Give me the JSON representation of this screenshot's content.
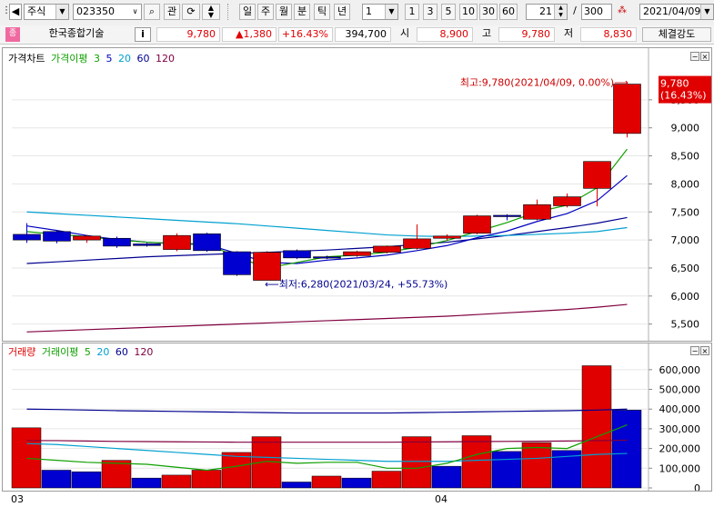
{
  "toolbar": {
    "market": "주식",
    "code": "023350",
    "btn_gwan": "관",
    "periods": [
      "일",
      "주",
      "월",
      "분",
      "틱",
      "년"
    ],
    "active_period": "일",
    "interval": "1",
    "quick": [
      "1",
      "3",
      "5",
      "10",
      "30",
      "60"
    ],
    "count": "21",
    "total": "300",
    "slash": "/",
    "date": "2021/04/09"
  },
  "info": {
    "badge": "종",
    "name": "한국종합기술",
    "i_label": "i",
    "price": "9,780",
    "change": "▲1,380",
    "rate": "+16.43%",
    "volume": "394,700",
    "open_label": "시",
    "open": "8,900",
    "high_label": "고",
    "high": "9,780",
    "low_label": "저",
    "low": "8,830",
    "strength_label": "체결강도"
  },
  "price_legend": {
    "title": "가격차트",
    "ma_label": "가격이평",
    "ma1": "3",
    "ma2": "5",
    "ma3": "20",
    "ma4": "60",
    "ma5": "120"
  },
  "volume_legend": {
    "title": "거래량",
    "ma_label": "거래이평",
    "ma1": "5",
    "ma2": "20",
    "ma3": "60",
    "ma4": "120"
  },
  "annotations": {
    "max": "최고:9,780(2021/04/09, 0.00%)⟶",
    "min": "⟵최저:6,280(2021/03/24, +55.73%)",
    "last_price": "9,780",
    "last_rate": "(16.43%)"
  },
  "x_labels": [
    "03",
    "04"
  ],
  "colors": {
    "up": "#e00000",
    "down": "#0000d0",
    "ma3": "#0fa000",
    "ma5": "#0000c0",
    "ma20": "#00a0d0",
    "ma60": "#000090",
    "ma120": "#800040"
  },
  "chart_data": [
    {
      "type": "candlestick",
      "ylim": [
        5300,
        10000
      ],
      "yticks": [
        "5,500",
        "6,000",
        "6,500",
        "7,000",
        "7,500",
        "8,000",
        "8,500",
        "9,000",
        "9,500"
      ],
      "ytick_values": [
        5500,
        6000,
        6500,
        7000,
        7500,
        8000,
        8500,
        9000,
        9500
      ],
      "candles": [
        {
          "o": 7000,
          "c": 7100,
          "h": 7300,
          "l": 6950,
          "dir": "down"
        },
        {
          "o": 7150,
          "c": 6980,
          "h": 7180,
          "l": 6940,
          "dir": "down"
        },
        {
          "o": 7000,
          "c": 7070,
          "h": 7090,
          "l": 6950,
          "dir": "up"
        },
        {
          "o": 7030,
          "c": 6890,
          "h": 7060,
          "l": 6860,
          "dir": "down"
        },
        {
          "o": 6930,
          "c": 6900,
          "h": 6950,
          "l": 6880,
          "dir": "down"
        },
        {
          "o": 6830,
          "c": 7080,
          "h": 7120,
          "l": 6800,
          "dir": "up"
        },
        {
          "o": 7110,
          "c": 6810,
          "h": 7130,
          "l": 6790,
          "dir": "down"
        },
        {
          "o": 6790,
          "c": 6380,
          "h": 6800,
          "l": 6360,
          "dir": "down"
        },
        {
          "o": 6280,
          "c": 6780,
          "h": 6800,
          "l": 6280,
          "dir": "up"
        },
        {
          "o": 6810,
          "c": 6680,
          "h": 6830,
          "l": 6660,
          "dir": "down"
        },
        {
          "o": 6690,
          "c": 6700,
          "h": 6720,
          "l": 6660,
          "dir": "down"
        },
        {
          "o": 6720,
          "c": 6790,
          "h": 6810,
          "l": 6700,
          "dir": "up"
        },
        {
          "o": 6780,
          "c": 6890,
          "h": 6900,
          "l": 6760,
          "dir": "up"
        },
        {
          "o": 6850,
          "c": 7020,
          "h": 7280,
          "l": 6830,
          "dir": "up"
        },
        {
          "o": 7030,
          "c": 7070,
          "h": 7100,
          "l": 6990,
          "dir": "up"
        },
        {
          "o": 7120,
          "c": 7430,
          "h": 7450,
          "l": 7100,
          "dir": "up"
        },
        {
          "o": 7430,
          "c": 7440,
          "h": 7460,
          "l": 7350,
          "dir": "down"
        },
        {
          "o": 7370,
          "c": 7630,
          "h": 7720,
          "l": 7350,
          "dir": "up"
        },
        {
          "o": 7610,
          "c": 7770,
          "h": 7830,
          "l": 7580,
          "dir": "up"
        },
        {
          "o": 7920,
          "c": 8400,
          "h": 8400,
          "l": 7600,
          "dir": "up"
        },
        {
          "o": 8900,
          "c": 9780,
          "h": 9780,
          "l": 8830,
          "dir": "up"
        }
      ],
      "ma3": [
        7150,
        7100,
        7060,
        7000,
        6960,
        6940,
        6930,
        6700,
        6500,
        6600,
        6700,
        6730,
        6780,
        6870,
        6990,
        7150,
        7310,
        7500,
        7620,
        7930,
        8620
      ],
      "ma5": [
        7250,
        7170,
        7080,
        7010,
        6960,
        6930,
        6920,
        6760,
        6600,
        6580,
        6640,
        6680,
        6730,
        6810,
        6900,
        7040,
        7160,
        7330,
        7470,
        7700,
        8150
      ],
      "ma20": [
        7500,
        7470,
        7440,
        7410,
        7380,
        7350,
        7320,
        7290,
        7250,
        7210,
        7170,
        7130,
        7090,
        7070,
        7060,
        7070,
        7080,
        7100,
        7120,
        7150,
        7220
      ],
      "ma60": [
        6580,
        6610,
        6640,
        6670,
        6700,
        6720,
        6740,
        6760,
        6780,
        6800,
        6820,
        6850,
        6880,
        6920,
        6960,
        7020,
        7080,
        7150,
        7220,
        7300,
        7400
      ],
      "ma120": [
        5360,
        5380,
        5400,
        5420,
        5440,
        5460,
        5480,
        5500,
        5520,
        5540,
        5560,
        5580,
        5600,
        5620,
        5640,
        5670,
        5700,
        5730,
        5760,
        5800,
        5850
      ]
    },
    {
      "type": "bar",
      "ylim": [
        0,
        650000
      ],
      "yticks": [
        "0",
        "100,000",
        "200,000",
        "300,000",
        "400,000",
        "500,000",
        "600,000"
      ],
      "ytick_values": [
        0,
        100000,
        200000,
        300000,
        400000,
        500000,
        600000
      ],
      "bars": [
        {
          "v": 305000,
          "dir": "up"
        },
        {
          "v": 90000,
          "dir": "down"
        },
        {
          "v": 82000,
          "dir": "down"
        },
        {
          "v": 140000,
          "dir": "up"
        },
        {
          "v": 50000,
          "dir": "down"
        },
        {
          "v": 65000,
          "dir": "up"
        },
        {
          "v": 90000,
          "dir": "up"
        },
        {
          "v": 180000,
          "dir": "up"
        },
        {
          "v": 260000,
          "dir": "up"
        },
        {
          "v": 30000,
          "dir": "down"
        },
        {
          "v": 60000,
          "dir": "up"
        },
        {
          "v": 50000,
          "dir": "down"
        },
        {
          "v": 85000,
          "dir": "up"
        },
        {
          "v": 260000,
          "dir": "up"
        },
        {
          "v": 110000,
          "dir": "down"
        },
        {
          "v": 265000,
          "dir": "up"
        },
        {
          "v": 185000,
          "dir": "down"
        },
        {
          "v": 230000,
          "dir": "up"
        },
        {
          "v": 190000,
          "dir": "down"
        },
        {
          "v": 620000,
          "dir": "up"
        },
        {
          "v": 394700,
          "dir": "down"
        }
      ],
      "ma5": [
        150000,
        140000,
        130000,
        125000,
        120000,
        105000,
        90000,
        110000,
        135000,
        125000,
        130000,
        130000,
        100000,
        100000,
        125000,
        170000,
        200000,
        205000,
        200000,
        260000,
        320000
      ],
      "ma20": [
        225000,
        220000,
        210000,
        200000,
        190000,
        180000,
        170000,
        160000,
        155000,
        150000,
        145000,
        140000,
        135000,
        135000,
        135000,
        140000,
        145000,
        150000,
        160000,
        170000,
        175000
      ],
      "ma60": [
        400000,
        398000,
        395000,
        392000,
        390000,
        388000,
        386000,
        384000,
        382000,
        380000,
        380000,
        380000,
        380000,
        382000,
        384000,
        386000,
        388000,
        390000,
        392000,
        395000,
        400000
      ],
      "ma120": [
        240000,
        240000,
        238000,
        236000,
        235000,
        234000,
        233000,
        232000,
        232000,
        232000,
        232000,
        232000,
        232000,
        233000,
        234000,
        235000,
        236000,
        237000,
        238000,
        240000,
        242000
      ]
    }
  ]
}
